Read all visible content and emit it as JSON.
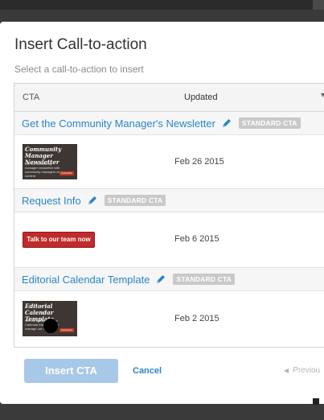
{
  "modal": {
    "title": "Insert Call-to-action",
    "subtitle": "Select a call-to-action to insert"
  },
  "table": {
    "columns": {
      "cta": "CTA",
      "updated": "Updated",
      "sort_icon": "▾"
    },
    "rows": [
      {
        "name": "Get the Community Manager's Newsletter",
        "badge": "STANDARD CTA",
        "date": "Feb 26 2015",
        "preview": {
          "title": "Community Manager Newsletter",
          "text": "Get the community manager newsletter with community managers and content",
          "button": "Subscribe"
        }
      },
      {
        "name": "Request Info",
        "badge": "STANDARD CTA",
        "date": "Feb 6 2015",
        "preview": {
          "button_label": "Talk to our team now",
          "button_color": "#c12b2b"
        }
      },
      {
        "name": "Editorial Calendar Template",
        "badge": "STANDARD CTA",
        "date": "Feb 2 2015",
        "preview": {
          "title": "Editorial Calendar Template",
          "text": "Get the actual Editorial Calendar that we use to manage our content",
          "button": "Download"
        }
      }
    ]
  },
  "footer": {
    "insert_label": "Insert CTA",
    "cancel_label": "Cancel",
    "previous_label": "Previou",
    "previous_arrow": "◀"
  },
  "colors": {
    "link": "#2a86c8",
    "badge": "#c9c9c9",
    "insert_button_disabled": "#a8c8e8"
  },
  "icons": [
    "pencil-icon",
    "sort-caret-icon",
    "previous-arrow-icon"
  ]
}
